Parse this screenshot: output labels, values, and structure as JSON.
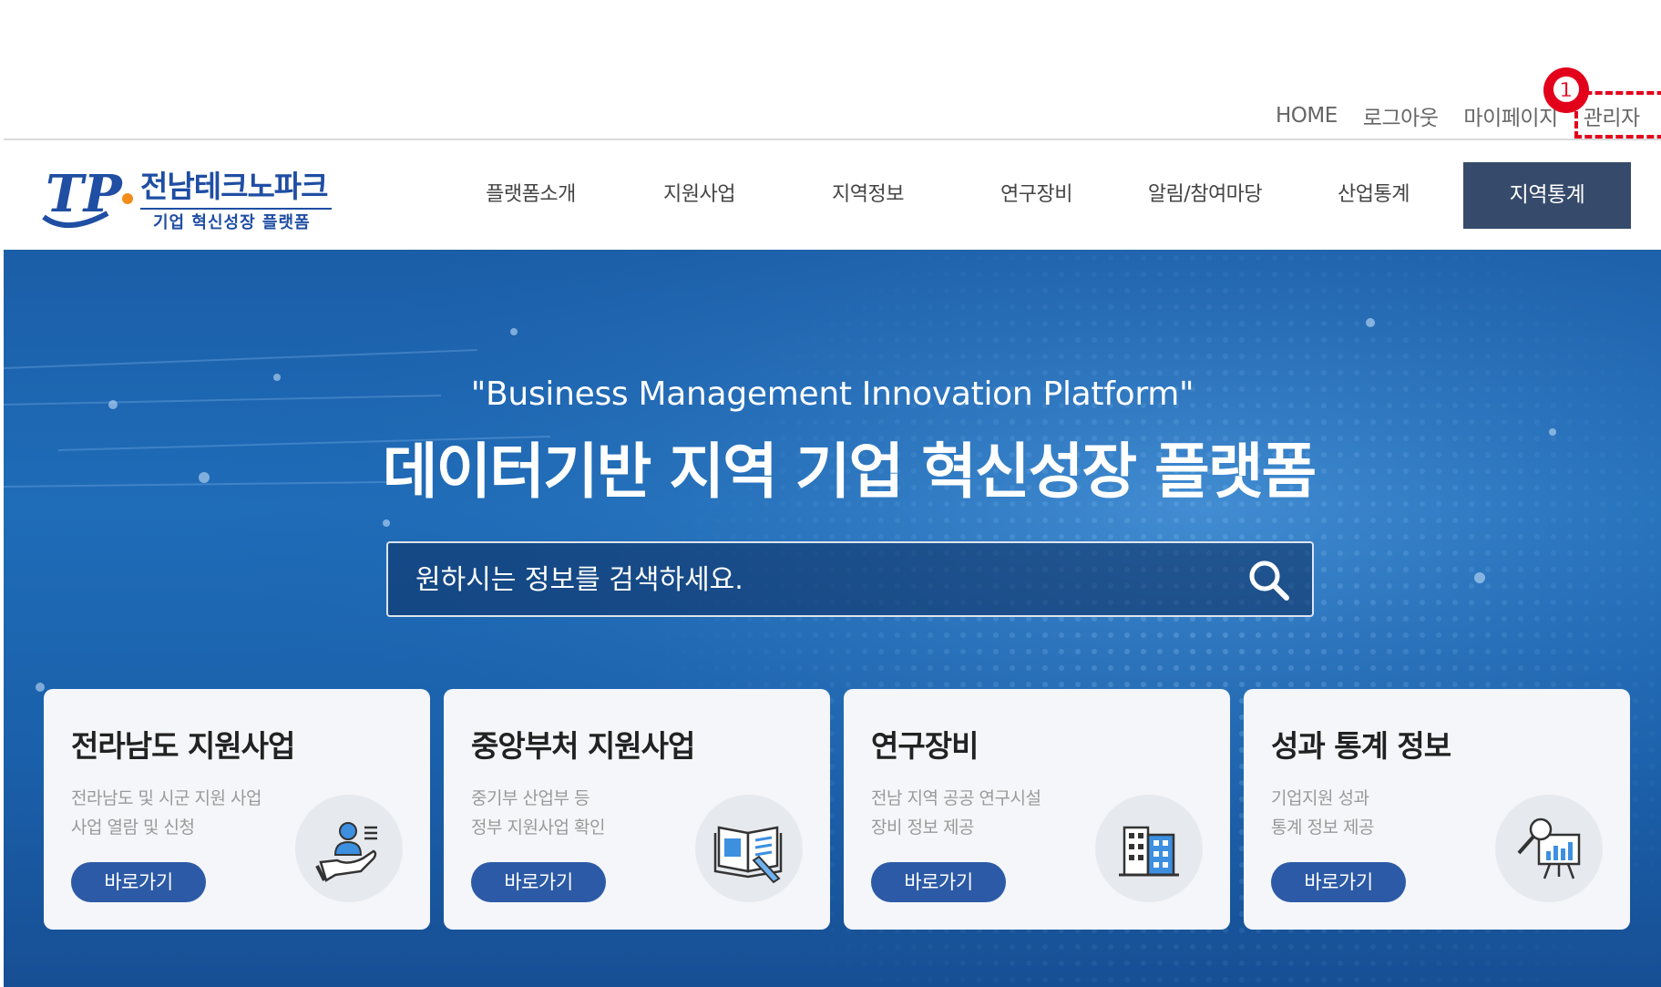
{
  "util_links": {
    "home": "HOME",
    "logout": "로그아웃",
    "mypage": "마이페이지",
    "admin": "관리자",
    "marker": "❶"
  },
  "logo": {
    "name": "전남테크노파크",
    "tagline": "기업 혁신성장 플랫폼",
    "initials": "TP"
  },
  "nav": {
    "items": [
      "플랫폼소개",
      "지원사업",
      "지역정보",
      "연구장비",
      "알림/참여마당",
      "산업통계"
    ],
    "cta": "지역통계"
  },
  "hero": {
    "quote": "\"Business Management Innovation Platform\"",
    "title": "데이터기반 지역 기업 혁신성장 플랫폼",
    "search_placeholder": "원하시는 정보를 검색하세요."
  },
  "cards": [
    {
      "title": "전라남도 지원사업",
      "desc1": "전라남도 및 시군 지원 사업",
      "desc2": "사업 열람 및 신청",
      "button": "바로가기",
      "icon": "hand-person-icon"
    },
    {
      "title": "중앙부처 지원사업",
      "desc1": "중기부 산업부 등",
      "desc2": "정부 지원사업 확인",
      "button": "바로가기",
      "icon": "book-icon"
    },
    {
      "title": "연구장비",
      "desc1": "전남 지역 공공 연구시설",
      "desc2": "장비 정보 제공",
      "button": "바로가기",
      "icon": "building-icon"
    },
    {
      "title": "성과 통계 정보",
      "desc1": "기업지원 성과",
      "desc2": "통계 정보 제공",
      "button": "바로가기",
      "icon": "chart-board-icon"
    }
  ],
  "colors": {
    "nav_cta_bg": "#364a6b",
    "card_button": "#2c5aa6",
    "marker_red": "#e3001b",
    "logo_blue": "#1f4ea3",
    "hero_blue": "#1f6cb8"
  }
}
